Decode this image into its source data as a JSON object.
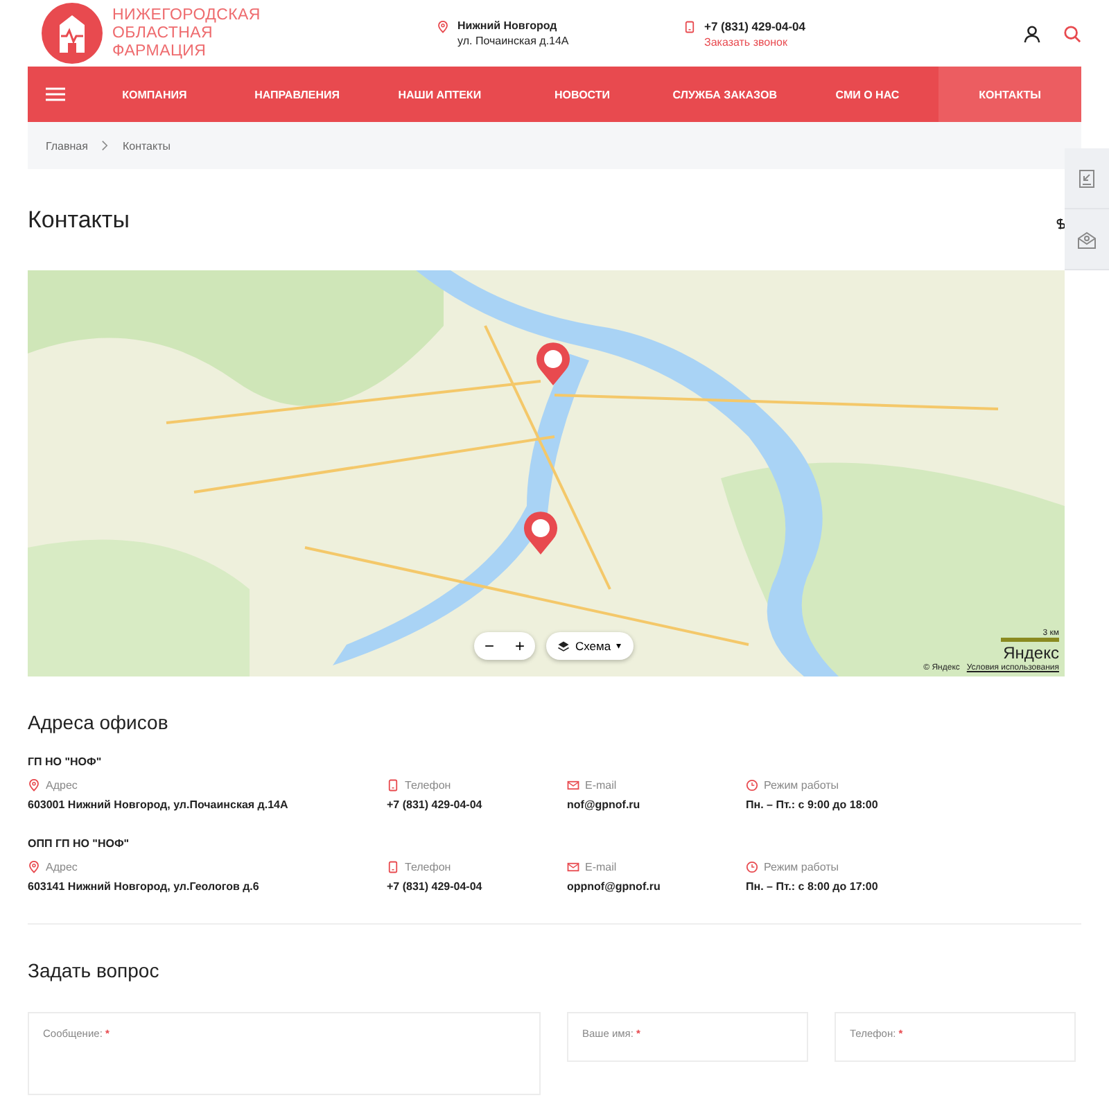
{
  "header": {
    "logo_text": [
      "НИЖЕГОРОДСКАЯ",
      "ОБЛАСТНАЯ",
      "ФАРМАЦИЯ"
    ],
    "city": "Нижний Новгород",
    "address": "ул. Почаинская д.14А",
    "phone": "+7 (831) 429-04-04",
    "callback_link": "Заказать звонок"
  },
  "nav": [
    {
      "label": "КОМПАНИЯ",
      "selected": false
    },
    {
      "label": "НАПРАВЛЕНИЯ",
      "selected": false
    },
    {
      "label": "НАШИ АПТЕКИ",
      "selected": false
    },
    {
      "label": "НОВОСТИ",
      "selected": false
    },
    {
      "label": "СЛУЖБА ЗАКАЗОВ",
      "selected": false
    },
    {
      "label": "СМИ О НАС",
      "selected": false
    },
    {
      "label": "КОНТАКТЫ",
      "selected": true
    }
  ],
  "breadcrumbs": [
    "Главная",
    "Контакты"
  ],
  "page_title": "Контакты",
  "map": {
    "zoom_out": "−",
    "zoom_in": "+",
    "layer_button": "Схема",
    "dropdown_arrow": "▾",
    "scale": "3 км",
    "brand": "Яндекс",
    "copyright": "© Яндекс",
    "terms_link": "Условия использования"
  },
  "offices_title": "Адреса офисов",
  "offices": [
    {
      "name": "ГП НО \"НОФ\"",
      "fields": [
        {
          "kind": "address",
          "label": "Адрес",
          "value": "603001 Нижний Новгород, ул.Почаинская д.14А"
        },
        {
          "kind": "phone",
          "label": "Телефон",
          "value": "+7 (831) 429-04-04"
        },
        {
          "kind": "email",
          "label": "E-mail",
          "value": "nof@gpnof.ru"
        },
        {
          "kind": "hours",
          "label": "Режим работы",
          "value": "Пн. – Пт.: с 9:00 до 18:00"
        }
      ]
    },
    {
      "name": "ОПП ГП НО \"НОФ\"",
      "fields": [
        {
          "kind": "address",
          "label": "Адрес",
          "value": "603141 Нижний Новгород, ул.Геологов д.6"
        },
        {
          "kind": "phone",
          "label": "Телефон",
          "value": "+7 (831) 429-04-04"
        },
        {
          "kind": "email",
          "label": "E-mail",
          "value": "oppnof@gpnof.ru"
        },
        {
          "kind": "hours",
          "label": "Режим работы",
          "value": "Пн. – Пт.: с 8:00 до 17:00"
        }
      ]
    }
  ],
  "form": {
    "title": "Задать вопрос",
    "fields": [
      {
        "label": "Сообщение:",
        "mark": "*"
      },
      {
        "label": "Ваше имя:",
        "mark": "*"
      },
      {
        "label": "Телефон:",
        "mark": "*"
      }
    ]
  }
}
